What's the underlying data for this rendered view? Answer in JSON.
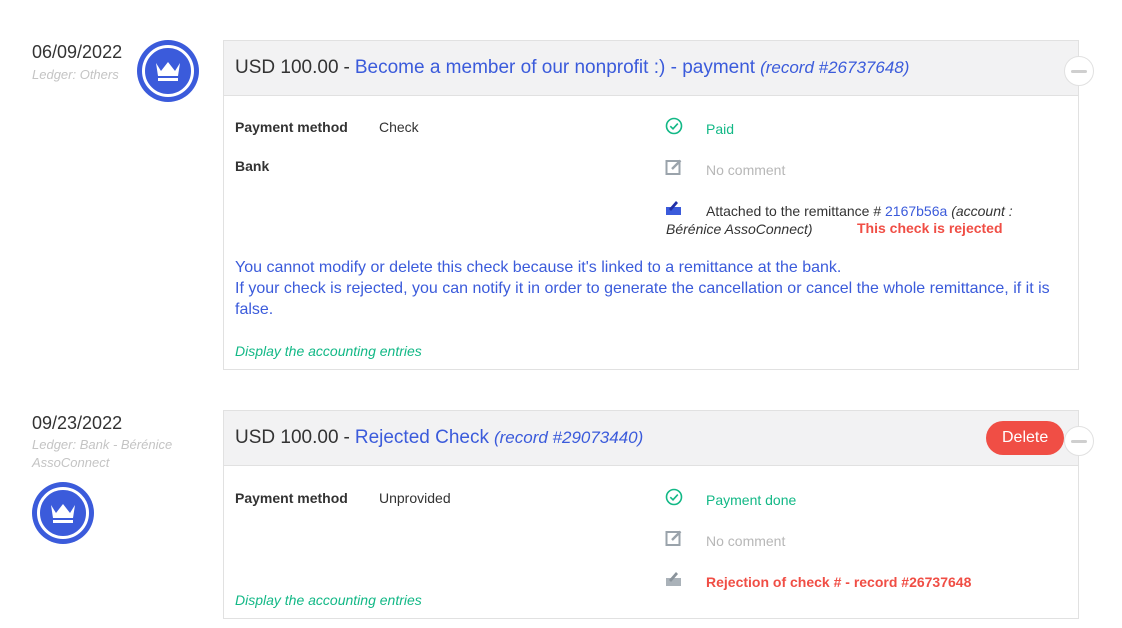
{
  "entries": [
    {
      "date": "06/09/2022",
      "ledger": "Ledger: Others",
      "amount": "USD 100.00",
      "separator": "-",
      "title": "Become a member of our nonprofit :) - payment",
      "record": "(record #26737648)",
      "payment_method_label": "Payment method",
      "payment_method_value": "Check",
      "bank_label": "Bank",
      "status": "Paid",
      "comment": "No comment",
      "remittance_prefix": "Attached to the remittance #",
      "remittance_id": "2167b56a",
      "remittance_account_open": "(account :",
      "remittance_account_close": "Bérénice AssoConnect)",
      "rejected_text": "This check is rejected",
      "note_line1": "You cannot modify or delete this check because it's linked to a remittance at the bank.",
      "note_line2": "If your check is rejected, you can notify it in order to generate the cancellation or cancel the whole remittance, if it is false.",
      "accounting_link": "Display the accounting entries"
    },
    {
      "date": "09/23/2022",
      "ledger_line1": "Ledger: Bank - Bérénice",
      "ledger_line2": "AssoConnect",
      "amount": "USD 100.00",
      "separator": "-",
      "title": "Rejected Check",
      "record": "(record #29073440)",
      "delete_label": "Delete",
      "payment_method_label": "Payment method",
      "payment_method_value": "Unprovided",
      "status": "Payment done",
      "comment": "No comment",
      "rejection_text": "Rejection of check # - record #26737648",
      "accounting_link": "Display the accounting entries"
    }
  ],
  "icons": {
    "avatar": "crown-icon",
    "status": "check-circle-icon",
    "comment": "edit-icon",
    "remittance": "check-paper-icon",
    "collapse": "minus-icon"
  },
  "colors": {
    "accent": "#3b5bdb",
    "success": "#12b886",
    "danger": "#f04e45"
  }
}
